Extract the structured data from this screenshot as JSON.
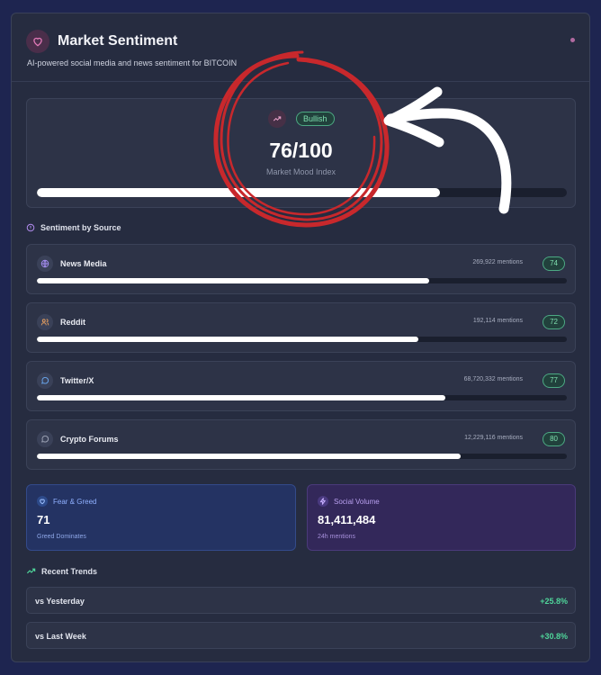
{
  "header": {
    "title": "Market Sentiment",
    "subtitle": "AI-powered social media and news sentiment for BITCOIN",
    "icon": "heart-icon"
  },
  "mood": {
    "badge": "Bullish",
    "value": "76/100",
    "label": "Market Mood Index",
    "score": 76,
    "icon": "trending-up-icon"
  },
  "sources": {
    "title": "Sentiment by Source",
    "items": [
      {
        "name": "News Media",
        "mentions": "269,922 mentions",
        "score": "74",
        "icon": "globe-icon"
      },
      {
        "name": "Reddit",
        "mentions": "192,114 mentions",
        "score": "72",
        "icon": "users-icon"
      },
      {
        "name": "Twitter/X",
        "mentions": "68,720,332 mentions",
        "score": "77",
        "icon": "chat-bubble-icon"
      },
      {
        "name": "Crypto Forums",
        "mentions": "12,229,116 mentions",
        "score": "80",
        "icon": "chat-bubble-icon"
      }
    ]
  },
  "stats": {
    "fear_greed": {
      "label": "Fear & Greed",
      "value": "71",
      "sub": "Greed Dominates",
      "icon": "heart-icon"
    },
    "social_volume": {
      "label": "Social Volume",
      "value": "81,411,484",
      "sub": "24h mentions",
      "icon": "lightning-icon"
    }
  },
  "trends": {
    "title": "Recent Trends",
    "items": [
      {
        "label": "vs Yesterday",
        "value": "+25.8%"
      },
      {
        "label": "vs Last Week",
        "value": "+30.8%"
      }
    ]
  },
  "colors": {
    "accent_green": "#4fd59a",
    "annotation_red": "#c8282c"
  }
}
